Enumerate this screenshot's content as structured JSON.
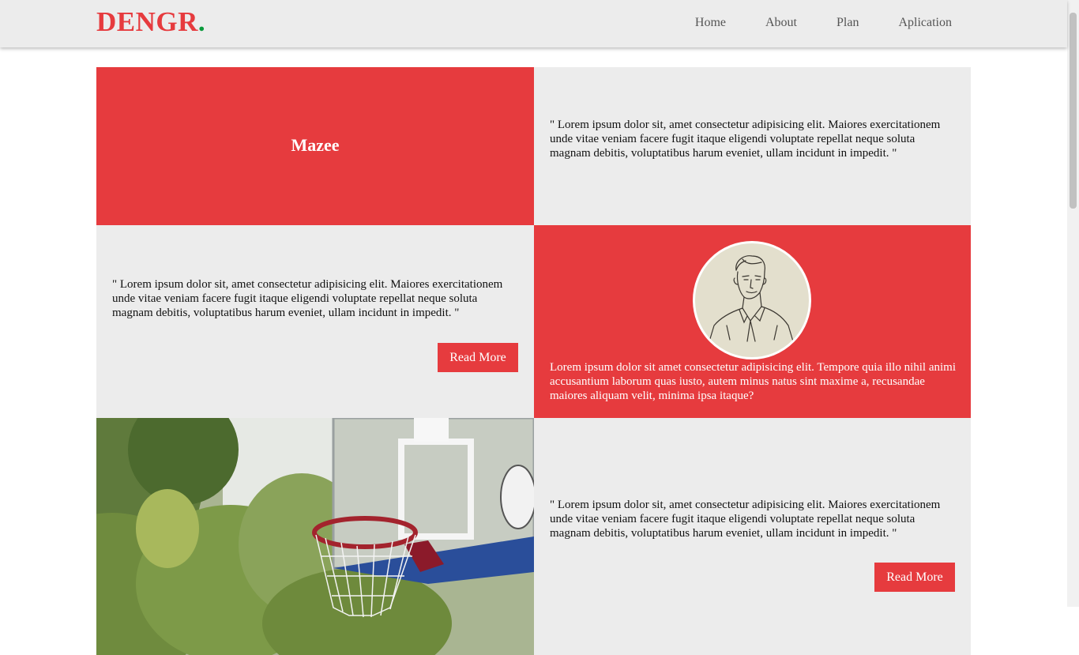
{
  "brand": {
    "name": "DENGR",
    "dot": ".",
    "accent": "#e63b3e",
    "dot_color": "#0a9a3c"
  },
  "nav": {
    "items": [
      "Home",
      "About",
      "Plan",
      "Aplication"
    ]
  },
  "cards": {
    "title_card": {
      "title": "Mazee"
    },
    "quote_1": {
      "text": "\" Lorem ipsum dolor sit, amet consectetur adipisicing elit. Maiores exercitationem unde vitae veniam facere fugit itaque eligendi voluptate repellat neque soluta magnam debitis, voluptatibus harum eveniet, ullam incidunt in impedit. \""
    },
    "quote_2": {
      "text": "\" Lorem ipsum dolor sit, amet consectetur adipisicing elit. Maiores exercitationem unde vitae veniam facere fugit itaque eligendi voluptate repellat neque soluta magnam debitis, voluptatibus harum eveniet, ullam incidunt in impedit. \"",
      "button": "Read More"
    },
    "profile": {
      "text": "Lorem ipsum dolor sit amet consectetur adipisicing elit. Tempore quia illo nihil animi accusantium laborum quas iusto, autem minus natus sint maxime a, recusandae maiores aliquam velit, minima ipsa itaque?"
    },
    "quote_3": {
      "text": "\" Lorem ipsum dolor sit, amet consectetur adipisicing elit. Maiores exercitationem unde vitae veniam facere fugit itaque eligendi voluptate repellat neque soluta magnam debitis, voluptatibus harum eveniet, ullam incidunt in impedit. \"",
      "button": "Read More"
    }
  }
}
